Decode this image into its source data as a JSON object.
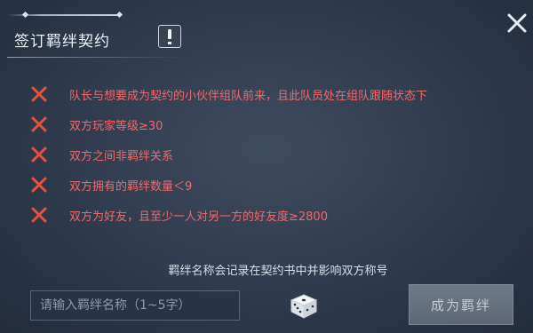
{
  "dialog": {
    "title": "签订羁绊契约",
    "close_icon": "close-icon",
    "alert_icon": "exclamation-icon"
  },
  "conditions": [
    {
      "status": "unmet",
      "icon": "x-icon",
      "text": "队长与想要成为契约的小伙伴组队前来，且此队员处在组队跟随状态下"
    },
    {
      "status": "unmet",
      "icon": "x-icon",
      "text": "双方玩家等级≥30"
    },
    {
      "status": "unmet",
      "icon": "x-icon",
      "text": "双方之间非羁绊关系"
    },
    {
      "status": "unmet",
      "icon": "x-icon",
      "text": "双方拥有的羁绊数量＜9"
    },
    {
      "status": "unmet",
      "icon": "x-icon",
      "text": "双方为好友，且至少一人对另一方的好友度≥2800"
    }
  ],
  "hint": "羁绊名称会记录在契约书中并影响双方称号",
  "name_input": {
    "value": "",
    "placeholder": "请输入羁绊名称（1~5字）"
  },
  "dice_icon": "dice-icon",
  "confirm_button": {
    "label": "成为羁绊",
    "state": "disabled"
  },
  "colors": {
    "unmet_text": "#ef6a6a",
    "unmet_icon": "#e8503f",
    "background": "#2f3a4c"
  }
}
